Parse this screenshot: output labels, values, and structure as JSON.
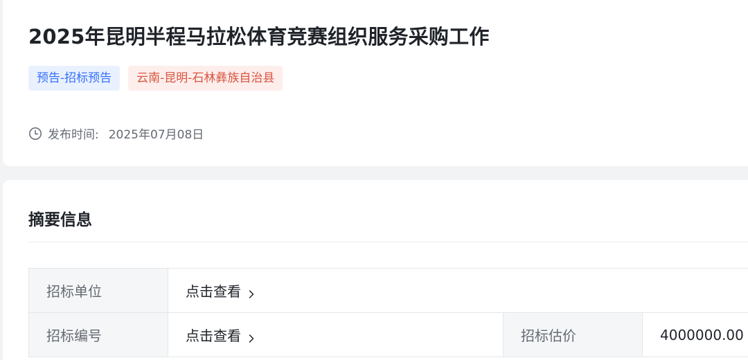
{
  "header": {
    "title": "2025年昆明半程马拉松体育竞赛组织服务采购工作",
    "tags": [
      {
        "label": "预告-招标预告"
      },
      {
        "label": "云南-昆明-石林彝族自治县"
      }
    ],
    "publish_label": "发布时间:",
    "publish_date": "2025年07月08日"
  },
  "summary": {
    "title": "摘要信息",
    "rows": [
      {
        "key": "招标单位",
        "value": "点击查看"
      },
      {
        "key": "招标编号",
        "value": "点击查看",
        "key2": "招标估价",
        "value2": "4000000.00"
      }
    ]
  },
  "icons": {
    "clock": "clock-icon",
    "chevron": "chevron-right-icon"
  },
  "colors": {
    "tag_blue_bg": "#eaf1fe",
    "tag_blue_text": "#3370ff",
    "tag_red_bg": "#fdeeec",
    "tag_red_text": "#d9543f"
  }
}
